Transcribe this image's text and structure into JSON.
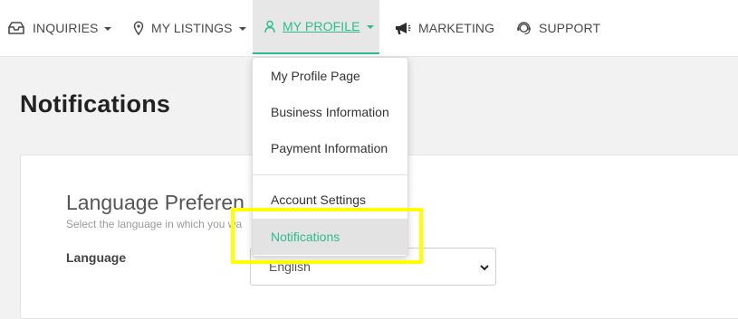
{
  "nav": {
    "items": [
      {
        "label": "INQUIRIES",
        "icon": "inbox-icon",
        "has_caret": true
      },
      {
        "label": "MY LISTINGS",
        "icon": "map-pin-icon",
        "has_caret": true
      },
      {
        "label": "MY PROFILE",
        "icon": "user-icon",
        "has_caret": true,
        "active": true
      },
      {
        "label": "MARKETING",
        "icon": "megaphone-icon",
        "has_caret": false
      },
      {
        "label": "SUPPORT",
        "icon": "headset-icon",
        "has_caret": false
      }
    ]
  },
  "page": {
    "title": "Notifications"
  },
  "language_section": {
    "title": "Language Preferen",
    "subtitle": "Select the language in which you wa",
    "field_label": "Language",
    "selected_value": "English"
  },
  "profile_menu": {
    "items": [
      {
        "label": "My Profile Page"
      },
      {
        "label": "Business Information"
      },
      {
        "label": "Payment Information"
      },
      {
        "label": "Account Settings"
      },
      {
        "label": "Notifications",
        "selected": true
      }
    ]
  },
  "colors": {
    "accent": "#2dbb8f",
    "highlight": "#ffff00"
  }
}
